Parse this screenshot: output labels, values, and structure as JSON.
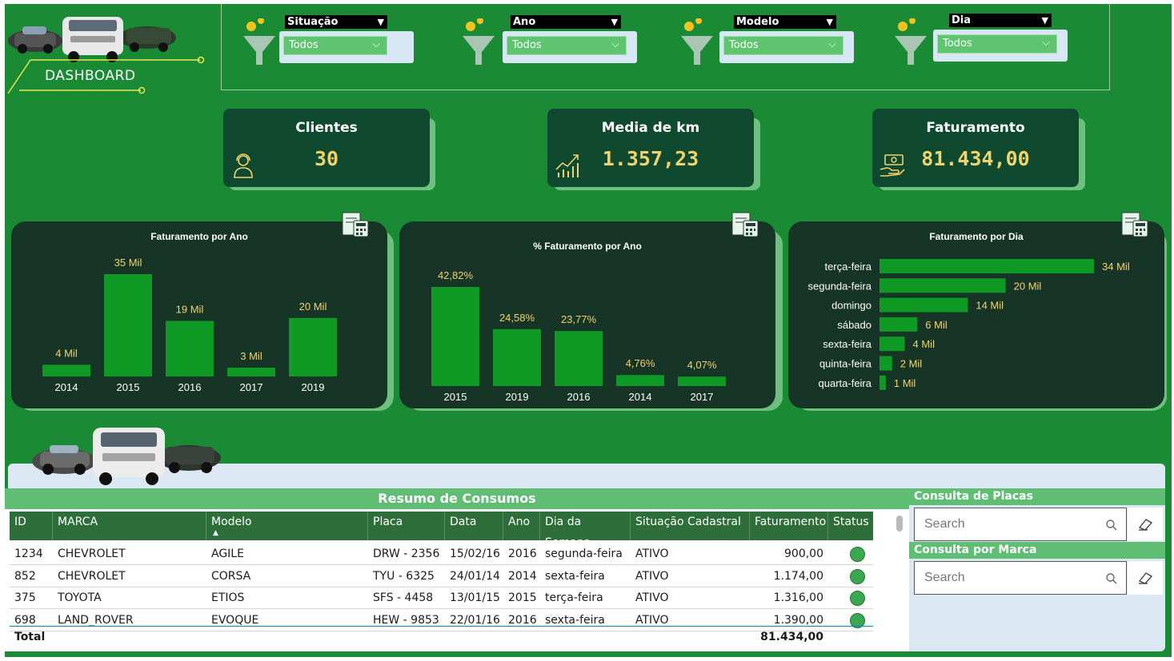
{
  "header": {
    "dashboard_label": "DASHBOARD"
  },
  "filters": [
    {
      "title": "Situação",
      "value": "Todos"
    },
    {
      "title": "Ano",
      "value": "Todos"
    },
    {
      "title": "Modelo",
      "value": "Todos"
    },
    {
      "title": "Dia",
      "value": "Todos"
    }
  ],
  "kpis": [
    {
      "title": "Clientes",
      "value": "30",
      "icon": "customer-support-icon"
    },
    {
      "title": "Media de km",
      "value": "1.357,23",
      "icon": "trend-chart-icon"
    },
    {
      "title": "Faturamento",
      "value": "81.434,00",
      "icon": "money-hand-icon"
    }
  ],
  "colors": {
    "background": "#1a8a34",
    "card": "#173526",
    "bar": "#0e9a25",
    "label": "#f2d36b",
    "kpi": "#0f4a30"
  },
  "chart_data": [
    {
      "type": "bar",
      "title": "Faturamento por Ano",
      "categories": [
        "2014",
        "2015",
        "2016",
        "2017",
        "2019"
      ],
      "values": [
        4,
        35,
        19,
        3,
        20
      ],
      "labels": [
        "4 Mil",
        "35 Mil",
        "19 Mil",
        "3 Mil",
        "20 Mil"
      ],
      "ylim": [
        0,
        35
      ]
    },
    {
      "type": "bar",
      "title": "% Faturamento por Ano",
      "categories": [
        "2015",
        "2019",
        "2016",
        "2014",
        "2017"
      ],
      "values": [
        42.82,
        24.58,
        23.77,
        4.76,
        4.07
      ],
      "labels": [
        "42,82%",
        "24,58%",
        "23,77%",
        "4,76%",
        "4,07%"
      ],
      "ylim": [
        0,
        42.82
      ]
    },
    {
      "type": "bar",
      "orientation": "horizontal",
      "title": "Faturamento por Dia",
      "categories": [
        "terça-feira",
        "segunda-feira",
        "domingo",
        "sábado",
        "sexta-feira",
        "quinta-feira",
        "quarta-feira"
      ],
      "values": [
        34,
        20,
        14,
        6,
        4,
        2,
        1
      ],
      "labels": [
        "34 Mil",
        "20 Mil",
        "14 Mil",
        "6 Mil",
        "4 Mil",
        "2 Mil",
        "1 Mil"
      ],
      "xlim": [
        0,
        34
      ]
    }
  ],
  "table": {
    "title": "Resumo de Consumos",
    "columns": [
      "ID",
      "MARCA",
      "Modelo",
      "Placa",
      "Data",
      "Ano",
      "Dia da Semana",
      "Situação Cadastral",
      "Faturamento",
      "Status"
    ],
    "sort_indicator": "▲",
    "rows": [
      [
        "1234",
        "CHEVROLET",
        "AGILE",
        "DRW - 2356",
        "15/02/16",
        "2016",
        "segunda-feira",
        "ATIVO",
        "900,00"
      ],
      [
        "852",
        "CHEVROLET",
        "CORSA",
        "TYU - 6325",
        "24/01/14",
        "2014",
        "sexta-feira",
        "ATIVO",
        "1.174,00"
      ],
      [
        "375",
        "TOYOTA",
        "ETIOS",
        "SFS - 4458",
        "13/01/15",
        "2015",
        "terça-feira",
        "ATIVO",
        "1.316,00"
      ],
      [
        "698",
        "LAND_ROVER",
        "EVOQUE",
        "HEW - 9853",
        "22/01/16",
        "2016",
        "sexta-feira",
        "ATIVO",
        "1.390,00"
      ]
    ],
    "total_label": "Total",
    "total_value": "81.434,00"
  },
  "consult": {
    "placas_title": "Consulta de Placas",
    "marca_title": "Consulta por Marca",
    "search_placeholder": "Search"
  }
}
